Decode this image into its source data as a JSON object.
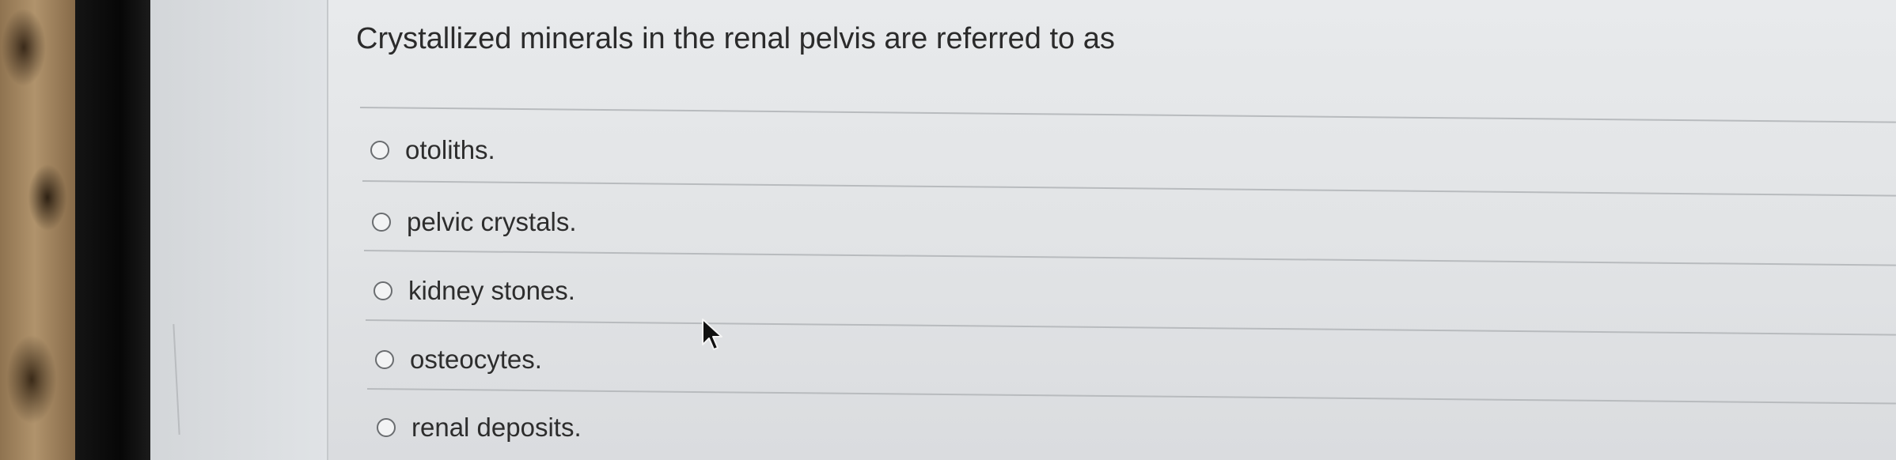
{
  "question": {
    "text": "Crystallized minerals in the renal pelvis are referred to as"
  },
  "options": [
    {
      "label": "otoliths.",
      "selected": false
    },
    {
      "label": "pelvic crystals.",
      "selected": false
    },
    {
      "label": "kidney stones.",
      "selected": false
    },
    {
      "label": "osteocytes.",
      "selected": false
    },
    {
      "label": "renal deposits.",
      "selected": false
    }
  ],
  "icons": {
    "cursor": "arrow-cursor-icon",
    "radio": "radio-button-icon"
  },
  "colors": {
    "text": "#2b2b2b",
    "panel": "#e4e6e8",
    "divider": "#b8bbbe"
  }
}
